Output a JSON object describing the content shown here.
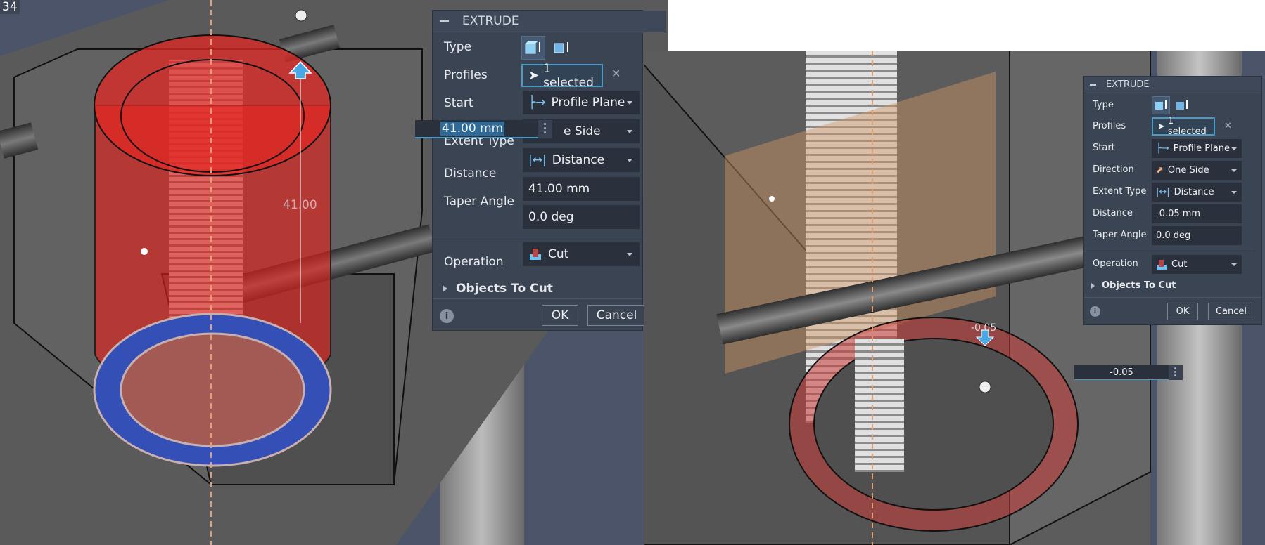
{
  "left": {
    "corner_label": "34",
    "dimension_label": "41.00",
    "panel": {
      "title": "EXTRUDE",
      "type_label": "Type",
      "profiles_label": "Profiles",
      "profiles_value": "1 selected",
      "start_label": "Start",
      "start_value": "Profile Plane",
      "direction_value_partial": "e Side",
      "extent_type_label": "Extent Type",
      "extent_type_value": "Distance",
      "distance_label": "Distance",
      "distance_value": "41.00 mm",
      "taper_label": "Taper Angle",
      "taper_value": "0.0 deg",
      "operation_label": "Operation",
      "operation_value": "Cut",
      "objects_to_cut": "Objects To Cut",
      "ok": "OK",
      "cancel": "Cancel"
    },
    "floating_input_value": "41.00 mm"
  },
  "right": {
    "dimension_label": "-0.05",
    "panel": {
      "title": "EXTRUDE",
      "type_label": "Type",
      "profiles_label": "Profiles",
      "profiles_value": "1 selected",
      "start_label": "Start",
      "start_value": "Profile Plane",
      "direction_label": "Direction",
      "direction_value": "One Side",
      "extent_type_label": "Extent Type",
      "extent_type_value": "Distance",
      "distance_label": "Distance",
      "distance_value": "-0.05 mm",
      "taper_label": "Taper Angle",
      "taper_value": "0.0 deg",
      "operation_label": "Operation",
      "operation_value": "Cut",
      "objects_to_cut": "Objects To Cut",
      "ok": "OK",
      "cancel": "Cancel"
    },
    "floating_input_value": "-0.05"
  },
  "colors": {
    "panel_bg": "#3b4453",
    "field_bg": "#2a313d",
    "accent": "#4a9ac8",
    "cut_red": "#e0302a",
    "profile_blue": "#3a55b8"
  }
}
